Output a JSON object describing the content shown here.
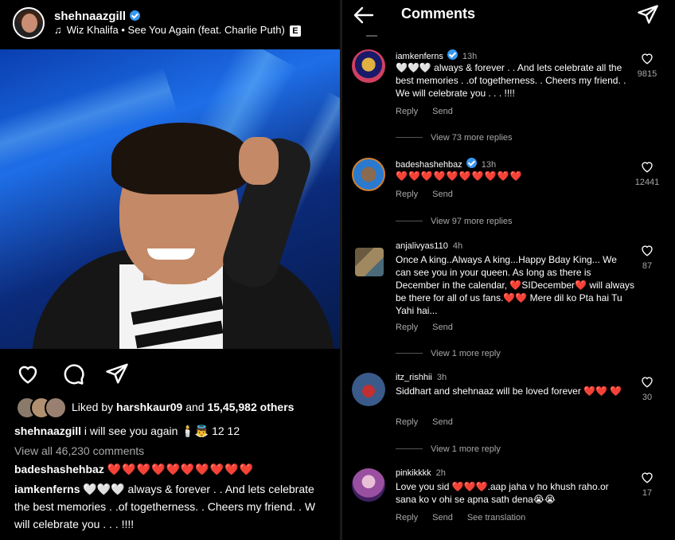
{
  "post": {
    "username": "shehnaazgill",
    "song": "Wiz Khalifa • See You Again (feat. Charlie Puth)",
    "explicit_badge": "E",
    "likes": {
      "prefix": "Liked by",
      "user": "harshkaur09",
      "and": "and",
      "count": "15,45,982 others"
    },
    "caption": {
      "user": "shehnaazgill",
      "text": "i will see you again 🕯️👼 12 12"
    },
    "view_all": "View all 46,230 comments",
    "comments": [
      {
        "user": "badeshashehbaz",
        "text": "❤️❤️❤️❤️❤️❤️❤️❤️❤️❤️"
      },
      {
        "user": "iamkenferns",
        "text_line1": "🤍🤍🤍 always & forever . .  And lets celebrate",
        "text_line2": "the best memories . .of togetherness. .  Cheers my friend. . W",
        "text_line3": "will celebrate you . . . !!!!"
      }
    ]
  },
  "comments_screen": {
    "title": "Comments",
    "reply_label": "Reply",
    "send_label": "Send",
    "items": [
      {
        "user": "iamkenferns",
        "time": "13h",
        "verified": true,
        "text": "🤍🤍🤍 always & forever . .  And lets celebrate all the best memories . .of togetherness. .  Cheers my friend. . We will celebrate you . . . !!!!",
        "likes": "9815",
        "more_replies": "View 73 more replies"
      },
      {
        "user": "badeshashehbaz",
        "time": "13h",
        "verified": true,
        "text": "❤️❤️❤️❤️❤️❤️❤️❤️❤️❤️",
        "likes": "12441",
        "more_replies": "View 97 more replies"
      },
      {
        "user": "anjalivyas110",
        "time": "4h",
        "verified": false,
        "text": "Once A king..Always A king...Happy Bday King... We can see you in your queen. As long as there is December in the calendar, ❤️SIDecember❤️ will always be there for all of us fans.❤️❤️ Mere dil ko Pta hai Tu Yahi hai...",
        "likes": "87",
        "more_replies": "View 1 more reply"
      },
      {
        "user": "itz_rishhii",
        "time": "3h",
        "verified": false,
        "text": "Siddhart and shehnaaz will be loved forever ❤️❤️ ❤️",
        "likes": "30",
        "more_replies": "View 1 more reply"
      },
      {
        "user": "pinkikkkk",
        "time": "2h",
        "verified": false,
        "text": "Love you sid ❤️❤️❤️.aap jaha v ho khush raho.or sana ko v ohi se apna sath dena😭😭",
        "likes": "17",
        "see_translation": "See translation"
      }
    ]
  },
  "colors": {
    "background": "#000000",
    "verified_blue": "#3897f0",
    "heart_red": "#ed1c24",
    "muted": "#a8a8a8"
  }
}
